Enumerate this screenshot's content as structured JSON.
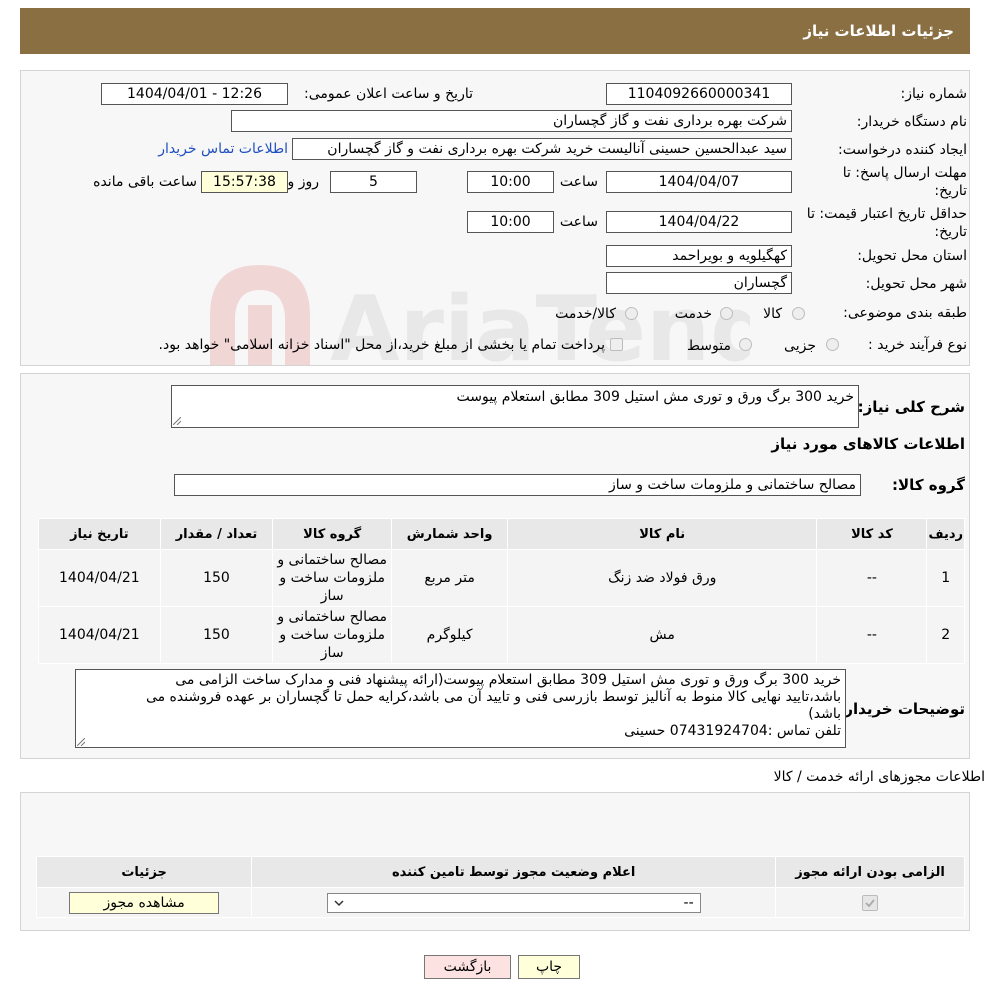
{
  "header": {
    "title": "جزئیات اطلاعات نیاز"
  },
  "info": {
    "need_number_label": "شماره نیاز:",
    "need_number": "1104092660000341",
    "announce_label": "تاریخ و ساعت اعلان عمومی:",
    "announce_value": "1404/04/01 - 12:26",
    "buyer_label": "نام دستگاه خریدار:",
    "buyer_value": "شرکت بهره برداری نفت و گاز گچساران",
    "creator_label": "ایجاد کننده درخواست:",
    "creator_value": "سید عبدالحسین حسینی آنالیست خرید شرکت بهره برداری نفت و گاز گچساران",
    "contact_link": "اطلاعات تماس خریدار",
    "deadline_label_1": "مهلت ارسال پاسخ: تا",
    "deadline_label_2": "تاریخ:",
    "deadline_date": "1404/04/07",
    "time_label": "ساعت",
    "deadline_time": "10:00",
    "days_value": "5",
    "days_label": "روز و",
    "remaining_time": "15:57:38",
    "remaining_label": "ساعت باقی مانده",
    "validity_label_1": "حداقل تاریخ اعتبار قیمت: تا",
    "validity_label_2": "تاریخ:",
    "validity_date": "1404/04/22",
    "validity_time": "10:00",
    "province_label": "استان محل تحویل:",
    "province_value": "کهگیلویه و بویراحمد",
    "city_label": "شهر محل تحویل:",
    "city_value": "گچساران",
    "category_label": "طبقه بندی موضوعی:",
    "category_options": [
      "کالا",
      "خدمت",
      "کالا/خدمت"
    ],
    "process_label": "نوع فرآیند خرید :",
    "process_options": [
      "جزیی",
      "متوسط"
    ],
    "process_note": "پرداخت تمام یا بخشی از مبلغ خرید،از محل \"اسناد خزانه اسلامی\" خواهد بود."
  },
  "summary": {
    "desc_label": "شرح کلی نیاز:",
    "desc_value": "خرید 300 برگ ورق و توری مش استیل 309 مطابق استعلام پیوست",
    "goods_info_title": "اطلاعات کالاهای مورد نیاز",
    "group_label": "گروه کالا:",
    "group_value": "مصالح ساختمانی و ملزومات ساخت و ساز"
  },
  "goods_table": {
    "headers": [
      "ردیف",
      "کد کالا",
      "نام کالا",
      "واحد شمارش",
      "گروه کالا",
      "تعداد / مقدار",
      "تاریخ نیاز"
    ],
    "rows": [
      [
        "1",
        "--",
        "ورق فولاد ضد زنگ",
        "متر مربع",
        "مصالح ساختمانی و ملزومات ساخت و ساز",
        "150",
        "1404/04/21"
      ],
      [
        "2",
        "--",
        "مش",
        "کیلوگرم",
        "مصالح ساختمانی و ملزومات ساخت و ساز",
        "150",
        "1404/04/21"
      ]
    ]
  },
  "buyer_notes": {
    "label": "توضیحات خریدار:",
    "line1": "خرید 300 برگ ورق و توری مش استیل 309 مطابق استعلام پیوست(ارائه پیشنهاد فنی و مدارک ساخت الزامی می",
    "line2": "باشد،تایید نهایی کالا منوط به آنالیز توسط بازرسی فنی و تایید آن می باشد،کرایه حمل تا گچساران بر عهده فروشنده می",
    "line3": "باشد)",
    "line4": "تلفن تماس :07431924704  حسینی"
  },
  "permits": {
    "section_title": "اطلاعات مجوزهای ارائه خدمت / کالا",
    "headers": [
      "الزامی بودن ارائه مجوز",
      "اعلام وضعیت مجوز توسط تامین کننده",
      "جزئیات"
    ],
    "select_value": "--",
    "view_button": "مشاهده مجوز"
  },
  "buttons": {
    "print": "چاپ",
    "back": "بازگشت"
  },
  "colors": {
    "header_bg": "#8a6f43",
    "yellow": "#ffffd9"
  }
}
